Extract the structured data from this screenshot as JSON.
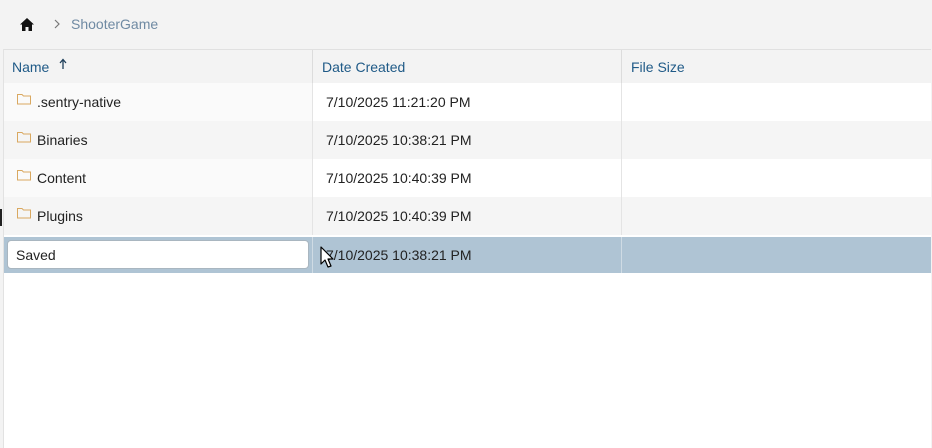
{
  "breadcrumb": {
    "home_icon": "home-icon",
    "separator_icon": "chevron-right-icon",
    "current": "ShooterGame"
  },
  "columns": {
    "name": "Name",
    "date_created": "Date Created",
    "file_size": "File Size",
    "sort_icon": "arrow-up-icon"
  },
  "rows": [
    {
      "name": ".sentry-native",
      "date": "7/10/2025 11:21:20 PM",
      "size": ""
    },
    {
      "name": "Binaries",
      "date": "7/10/2025 10:38:21 PM",
      "size": ""
    },
    {
      "name": "Content",
      "date": "7/10/2025 10:40:39 PM",
      "size": ""
    },
    {
      "name": "Plugins",
      "date": "7/10/2025 10:40:39 PM",
      "size": ""
    }
  ],
  "editing_row": {
    "name_value": "Saved",
    "date": "7/10/2025 10:38:21 PM",
    "size": ""
  },
  "colors": {
    "selected_row": "#afc4d4",
    "header_text": "#1f5a87",
    "folder_icon": "#d9a860"
  }
}
